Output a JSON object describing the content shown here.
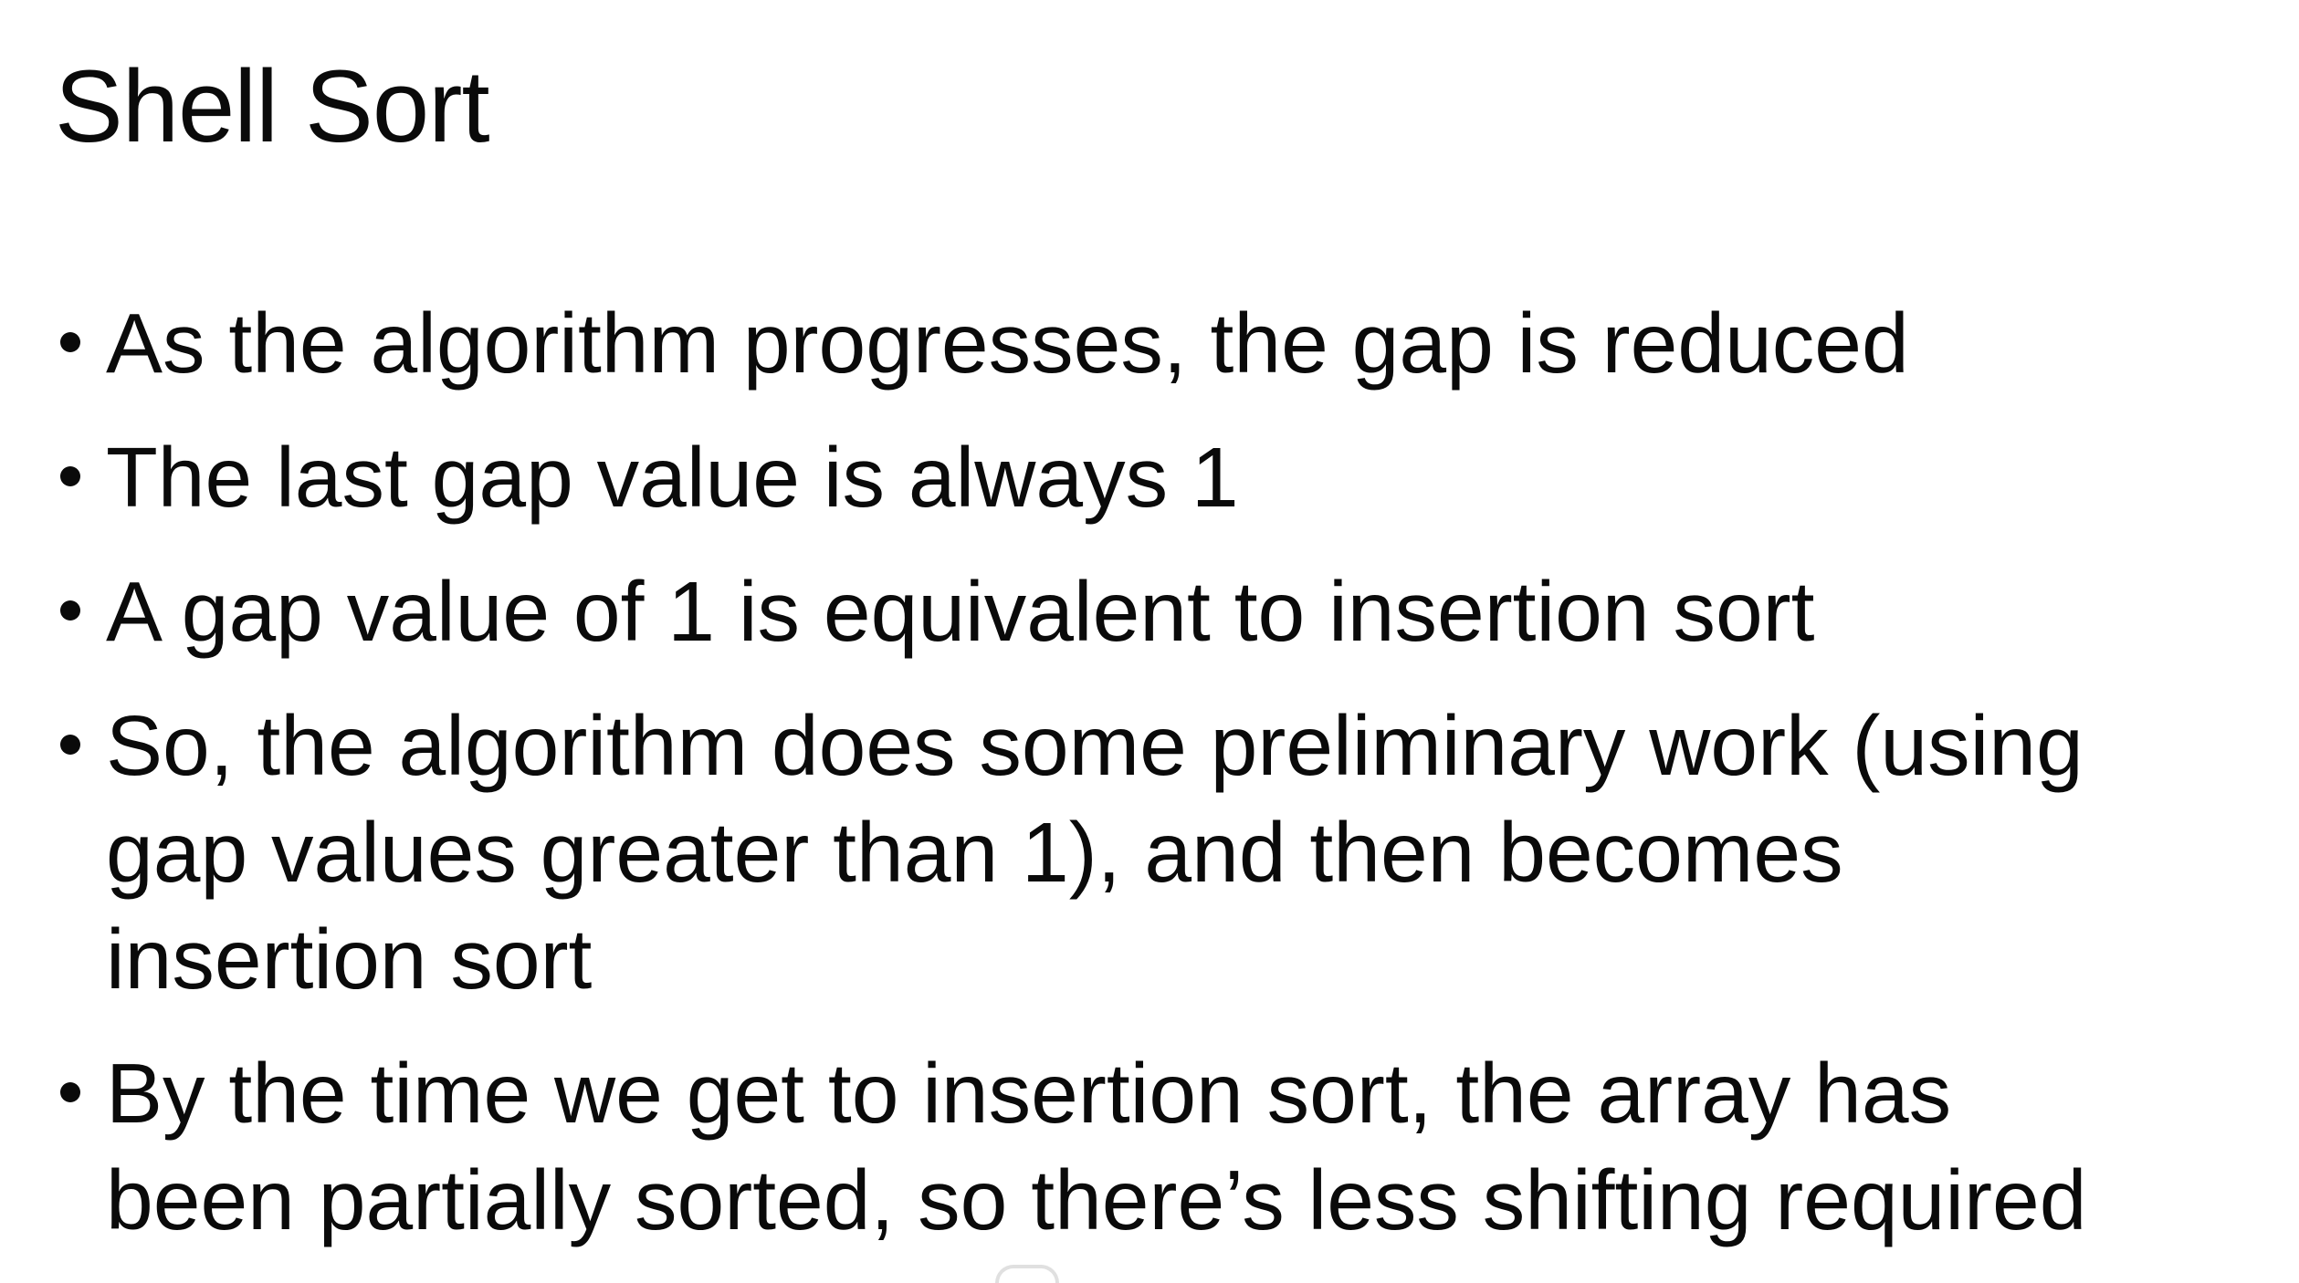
{
  "slide": {
    "title": "Shell Sort",
    "bullets": [
      {
        "lines": [
          "As the algorithm progresses, the gap is reduced"
        ]
      },
      {
        "lines": [
          "The last gap value is always 1"
        ]
      },
      {
        "lines": [
          "A gap value of 1 is equivalent to insertion sort"
        ]
      },
      {
        "lines": [
          "So, the algorithm does some preliminary work (using",
          "gap values greater than 1), and then becomes",
          "insertion sort"
        ]
      },
      {
        "lines": [
          "By the time we get to insertion sort, the array has",
          "been partially sorted, so there’s less shifting required"
        ]
      }
    ]
  }
}
